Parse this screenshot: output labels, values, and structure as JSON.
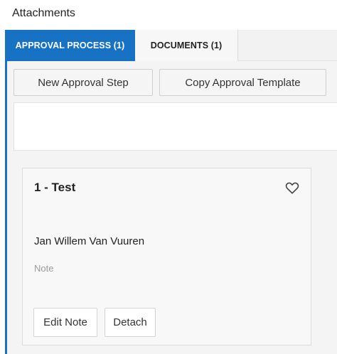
{
  "header": {
    "title": "Attachments"
  },
  "tabs": [
    {
      "label": "APPROVAL PROCESS (1)",
      "active": true
    },
    {
      "label": "DOCUMENTS (1)",
      "active": false
    }
  ],
  "toolbar": {
    "new_step_label": "New Approval Step",
    "copy_template_label": "Copy Approval Template"
  },
  "card": {
    "title": "1 - Test",
    "assignee": "Jan Willem Van Vuuren",
    "note_placeholder": "Note",
    "edit_note_label": "Edit Note",
    "detach_label": "Detach",
    "favorite_icon": "heart-outline-icon"
  },
  "colors": {
    "accent": "#1872c4",
    "panel_bg": "#f4f4f4",
    "card_bg": "#f8f8f8"
  }
}
